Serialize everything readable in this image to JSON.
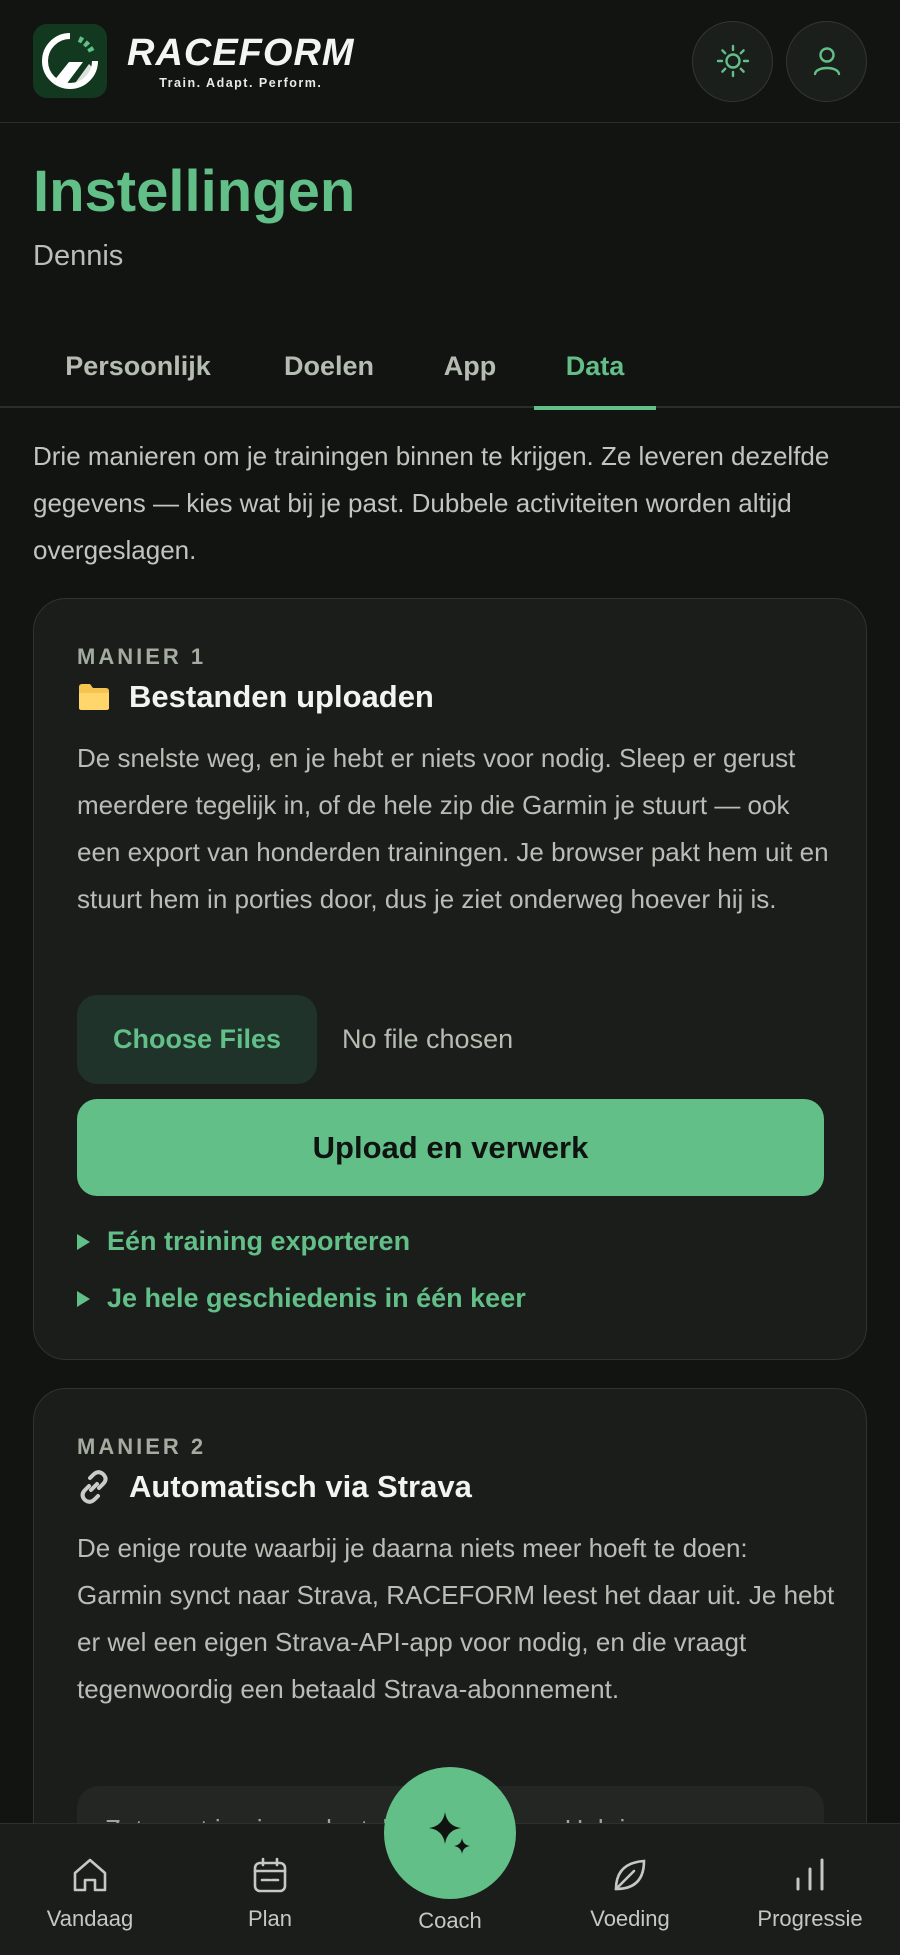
{
  "header": {
    "logo_word": "RACEFORM",
    "logo_tagline": "Train. Adapt. Perform.",
    "theme_icon": "sun-icon",
    "profile_icon": "user-icon"
  },
  "page": {
    "title": "Instellingen",
    "subtitle": "Dennis"
  },
  "tabs": [
    {
      "label": "Persoonlijk",
      "active": false
    },
    {
      "label": "Doelen",
      "active": false
    },
    {
      "label": "App",
      "active": false
    },
    {
      "label": "Data",
      "active": true
    }
  ],
  "intro": "Drie manieren om je trainingen binnen te krijgen. Ze leveren dezelfde gegevens — kies wat bij je past. Dubbele activiteiten worden altijd overgeslagen.",
  "method1": {
    "kicker": "MANIER 1",
    "title": "Bestanden uploaden",
    "icon": "folder-icon",
    "body": "De snelste weg, en je hebt er niets voor nodig. Sleep er gerust meerdere tegelijk in, of de hele zip die Garmin je stuurt — ook een export van honderden trainingen. Je browser pakt hem uit en stuurt hem in porties door, dus je ziet onderweg hoever hij is.",
    "choose_files": "Choose Files",
    "no_file": "No file chosen",
    "upload_button": "Upload en verwerk",
    "details": [
      "Eén training exporteren",
      "Je hele geschiedenis in één keer"
    ]
  },
  "method2": {
    "kicker": "MANIER 2",
    "title": "Automatisch via Strava",
    "icon": "link-icon",
    "body": "De enige route waarbij je daarna niets meer hoeft te doen: Garmin synct naar Strava, RACEFORM leest het daar uit. Je hebt er wel een eigen Strava-API-app voor nodig, en die vraagt tegenwoordig een betaald Strava-abonnement.",
    "note": "Zet eerst je eigen sleutels in orde klaar. Heb je"
  },
  "bottom_nav": [
    {
      "label": "Vandaag",
      "icon": "home-icon"
    },
    {
      "label": "Plan",
      "icon": "calendar-icon"
    },
    {
      "label": "Coach",
      "icon": "sparkle-icon"
    },
    {
      "label": "Voeding",
      "icon": "leaf-icon"
    },
    {
      "label": "Progressie",
      "icon": "bar-chart-icon"
    }
  ],
  "colors": {
    "accent": "#62bf88",
    "background": "#121412",
    "card": "#1a1d1a"
  }
}
